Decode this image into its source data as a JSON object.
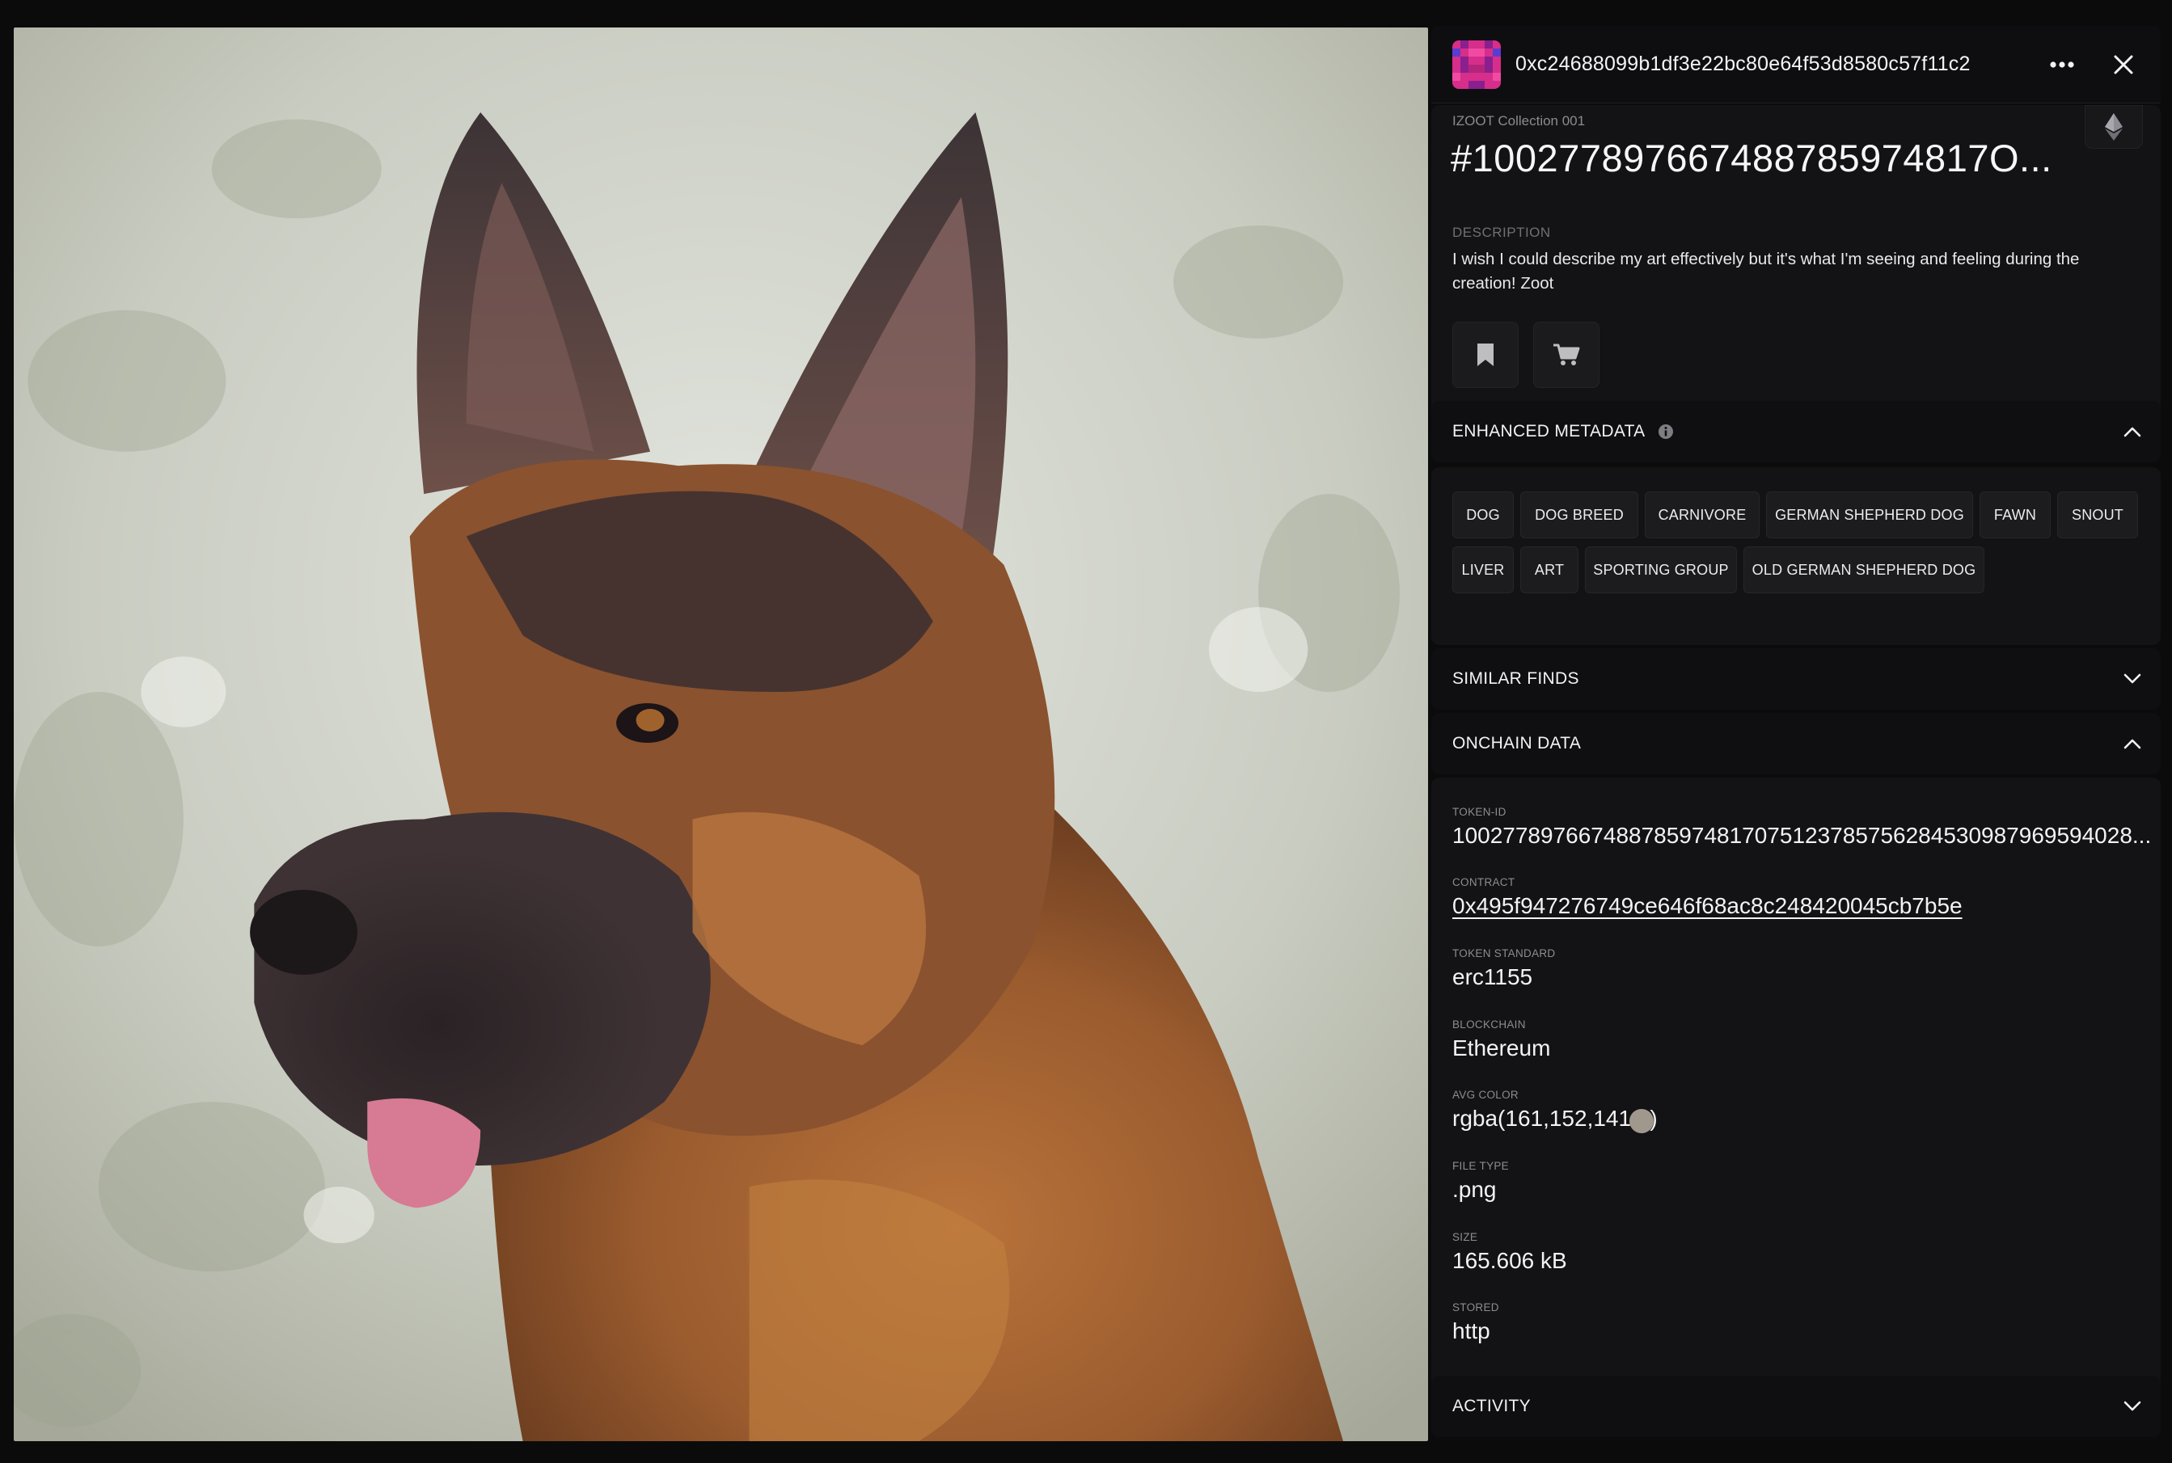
{
  "header": {
    "owner_address": "0xc24688099b1df3e22bc80e64f53d8580c57f11c2",
    "more_icon": "more-horizontal-icon",
    "close_icon": "close-icon"
  },
  "artwork": {
    "subject": "german-shepherd-painting"
  },
  "item": {
    "collection": "IZOOT Collection 001",
    "title": "#100277897667488785974817O...",
    "chain_icon": "ethereum-icon",
    "description_label": "DESCRIPTION",
    "description": "I wish I could describe my art effectively but it's what I'm seeing and feeling during the creation! Zoot",
    "actions": [
      "bookmark-icon",
      "cart-icon"
    ]
  },
  "enhanced_metadata": {
    "title": "ENHANCED METADATA",
    "tags": [
      "DOG",
      "DOG BREED",
      "CARNIVORE",
      "GERMAN SHEPHERD DOG",
      "FAWN",
      "SNOUT",
      "LIVER",
      "ART",
      "SPORTING GROUP",
      "OLD GERMAN SHEPHERD DOG"
    ]
  },
  "similar_finds": {
    "title": "SIMILAR FINDS"
  },
  "onchain": {
    "title": "ONCHAIN DATA",
    "fields": [
      {
        "label": "TOKEN-ID",
        "value": "100277897667488785974817075123785756284530987969594028..."
      },
      {
        "label": "CONTRACT",
        "value": "0x495f947276749ce646f68ac8c248420045cb7b5e"
      },
      {
        "label": "TOKEN STANDARD",
        "value": "erc1155"
      },
      {
        "label": "BLOCKCHAIN",
        "value": "Ethereum"
      },
      {
        "label": "AVG COLOR",
        "value": "rgba(161,152,141,1)"
      },
      {
        "label": "FILE TYPE",
        "value": ".png"
      },
      {
        "label": "SIZE",
        "value": "165.606 kB"
      },
      {
        "label": "STORED",
        "value": "http"
      }
    ]
  },
  "activity": {
    "title": "ACTIVITY"
  },
  "colors": {
    "background": "#0b0b0c",
    "panel": "#131315",
    "avg_color": "#a1988d",
    "avatar_primary": "#d62e8a"
  }
}
